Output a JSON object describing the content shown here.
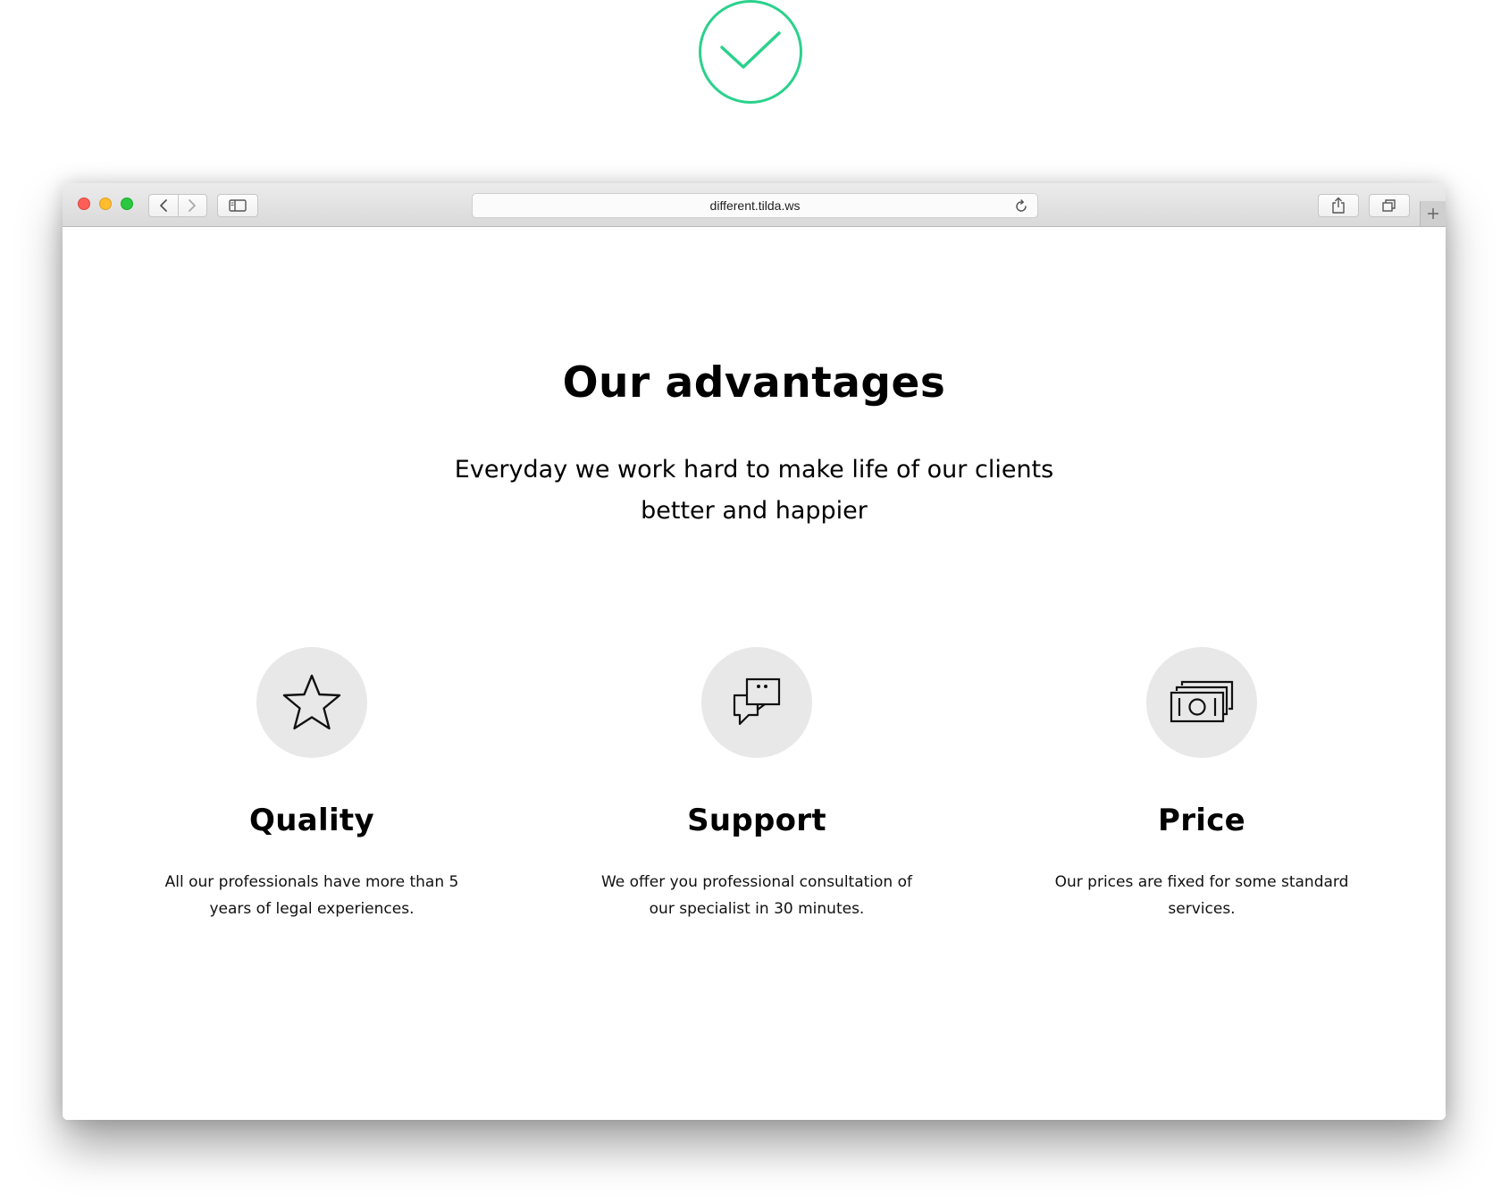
{
  "browser": {
    "url": "different.tilda.ws"
  },
  "page": {
    "heading": "Our advantages",
    "subheading": "Everyday we work hard to make life of our clients better and happier",
    "features": [
      {
        "icon": "star-icon",
        "title": "Quality",
        "description": "All our professionals have more than 5 years of legal experiences."
      },
      {
        "icon": "chat-bubbles-icon",
        "title": "Support",
        "description": "We offer you professional consultation of our specialist in 30 minutes."
      },
      {
        "icon": "money-stack-icon",
        "title": "Price",
        "description": "Our prices are fixed for some standard services."
      }
    ]
  },
  "colors": {
    "check_badge": "#2bd18c",
    "icon_circle": "#e8e8e8",
    "close": "#fd5f57",
    "minimize": "#febc2e",
    "maximize": "#29c840"
  }
}
